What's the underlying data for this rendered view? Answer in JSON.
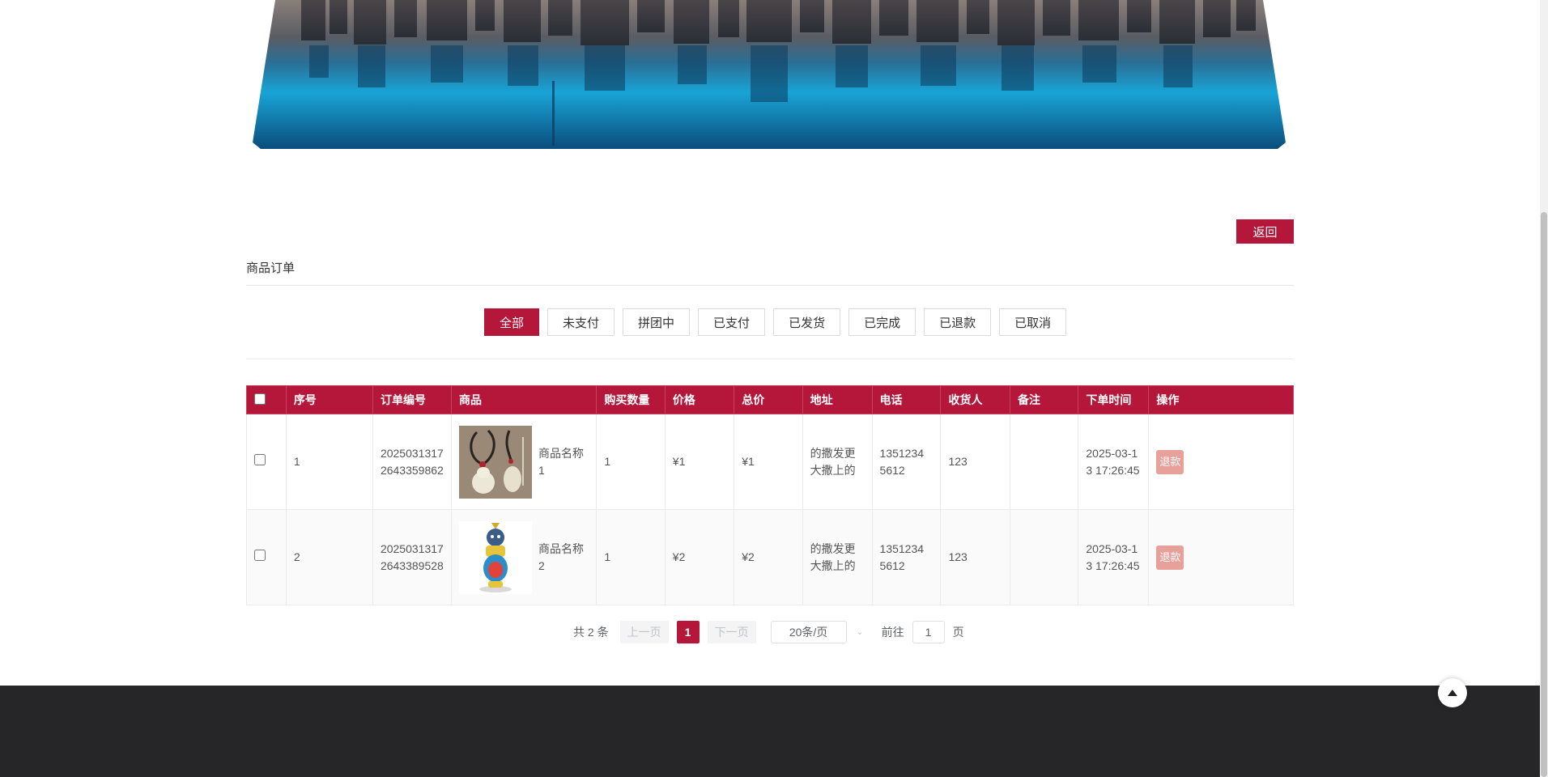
{
  "header": {
    "back_label": "返回"
  },
  "section": {
    "title": "商品订单"
  },
  "filters": [
    "全部",
    "未支付",
    "拼团中",
    "已支付",
    "已发货",
    "已完成",
    "已退款",
    "已取消"
  ],
  "active_filter": "全部",
  "table": {
    "columns": [
      "序号",
      "订单编号",
      "商品",
      "购买数量",
      "价格",
      "总价",
      "地址",
      "电话",
      "收货人",
      "备注",
      "下单时间",
      "操作"
    ],
    "rows": [
      {
        "index": "1",
        "order_no": "20250313172643359862",
        "product_name": "商品名称1",
        "quantity": "1",
        "price": "¥1",
        "total": "¥1",
        "address": "的撒发更大撒上的",
        "phone": "13512345612",
        "receiver": "123",
        "remark": "",
        "order_time": "2025-03-13 17:26:45",
        "action": "退款"
      },
      {
        "index": "2",
        "order_no": "20250313172643389528",
        "product_name": "商品名称2",
        "quantity": "1",
        "price": "¥2",
        "total": "¥2",
        "address": "的撒发更大撒上的",
        "phone": "13512345612",
        "receiver": "123",
        "remark": "",
        "order_time": "2025-03-13 17:26:45",
        "action": "退款"
      }
    ]
  },
  "pagination": {
    "total_text": "共 2 条",
    "prev": "上一页",
    "current": "1",
    "next": "下一页",
    "page_size": "20条/页",
    "goto_label": "前往",
    "goto_value": "1",
    "page_suffix": "页"
  },
  "colors": {
    "accent": "#b5173a",
    "refund_button": "#e8a09a",
    "footer": "#262628"
  },
  "icons": {
    "back_to_top": "caret-up-icon",
    "page_size_arrow": "chevron-down-icon"
  }
}
